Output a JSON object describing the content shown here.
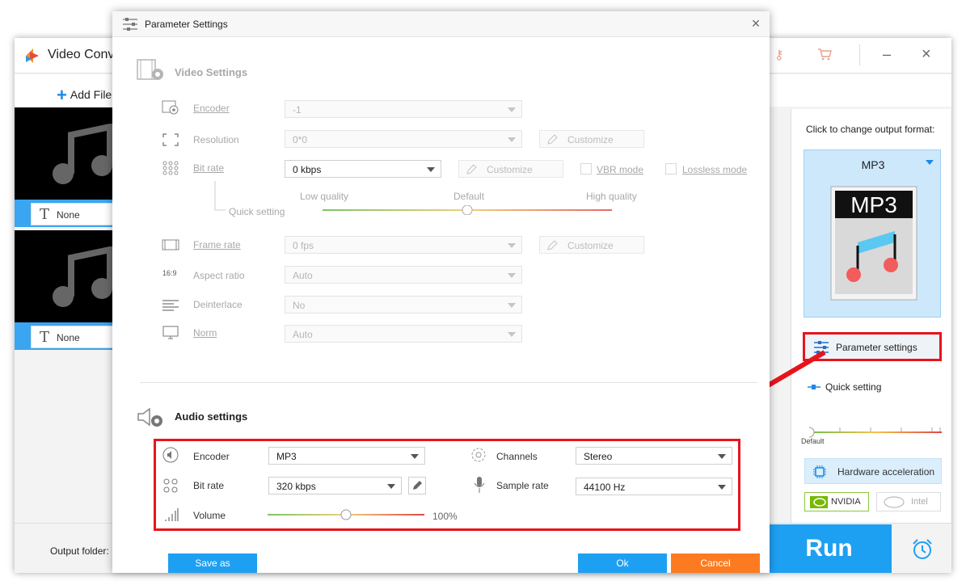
{
  "main_window": {
    "title": "Video Conv",
    "toolbar": {
      "add_files": "Add File"
    },
    "files": [
      {
        "subtitle": "None"
      },
      {
        "subtitle": "None"
      }
    ],
    "output_folder_label": "Output folder:",
    "run_label": "Run",
    "right_panel": {
      "output_format_label": "Click to change output format:",
      "format_name": "MP3",
      "format_icon_text": "MP3",
      "parameter_settings_label": "Parameter settings",
      "quick_setting_label": "Quick setting",
      "slider_default_label": "Default",
      "hardware_acceleration_label": "Hardware acceleration",
      "nvidia_label": "NVIDIA",
      "intel_label": "Intel"
    }
  },
  "dialog": {
    "title": "Parameter Settings",
    "video": {
      "section_title": "Video Settings",
      "encoder": {
        "label": "Encoder",
        "value": "-1"
      },
      "resolution": {
        "label": "Resolution",
        "value": "0*0",
        "customize": "Customize"
      },
      "bitrate": {
        "label": "Bit rate",
        "value": "0 kbps",
        "customize": "Customize",
        "vbr_mode": "VBR mode",
        "lossless_mode": "Lossless mode"
      },
      "quick_setting": {
        "label": "Quick setting",
        "low": "Low quality",
        "default": "Default",
        "high": "High quality",
        "level": 0.5
      },
      "frame_rate": {
        "label": "Frame rate",
        "value": "0 fps",
        "customize": "Customize"
      },
      "aspect_ratio": {
        "label": "Aspect ratio",
        "value": "Auto"
      },
      "deinterlace": {
        "label": "Deinterlace",
        "value": "No"
      },
      "norm": {
        "label": "Norm",
        "value": "Auto"
      }
    },
    "audio": {
      "section_title": "Audio settings",
      "encoder": {
        "label": "Encoder",
        "value": "MP3"
      },
      "bitrate": {
        "label": "Bit rate",
        "value": "320 kbps"
      },
      "volume": {
        "label": "Volume",
        "value": "100%",
        "level": 0.5
      },
      "channels": {
        "label": "Channels",
        "value": "Stereo"
      },
      "sample_rate": {
        "label": "Sample rate",
        "value": "44100 Hz"
      }
    },
    "buttons": {
      "save_as": "Save as",
      "ok": "Ok",
      "cancel": "Cancel"
    }
  },
  "colors": {
    "accent": "#1ea0f2",
    "cancel": "#fd7b20",
    "highlight": "#e8141c"
  }
}
